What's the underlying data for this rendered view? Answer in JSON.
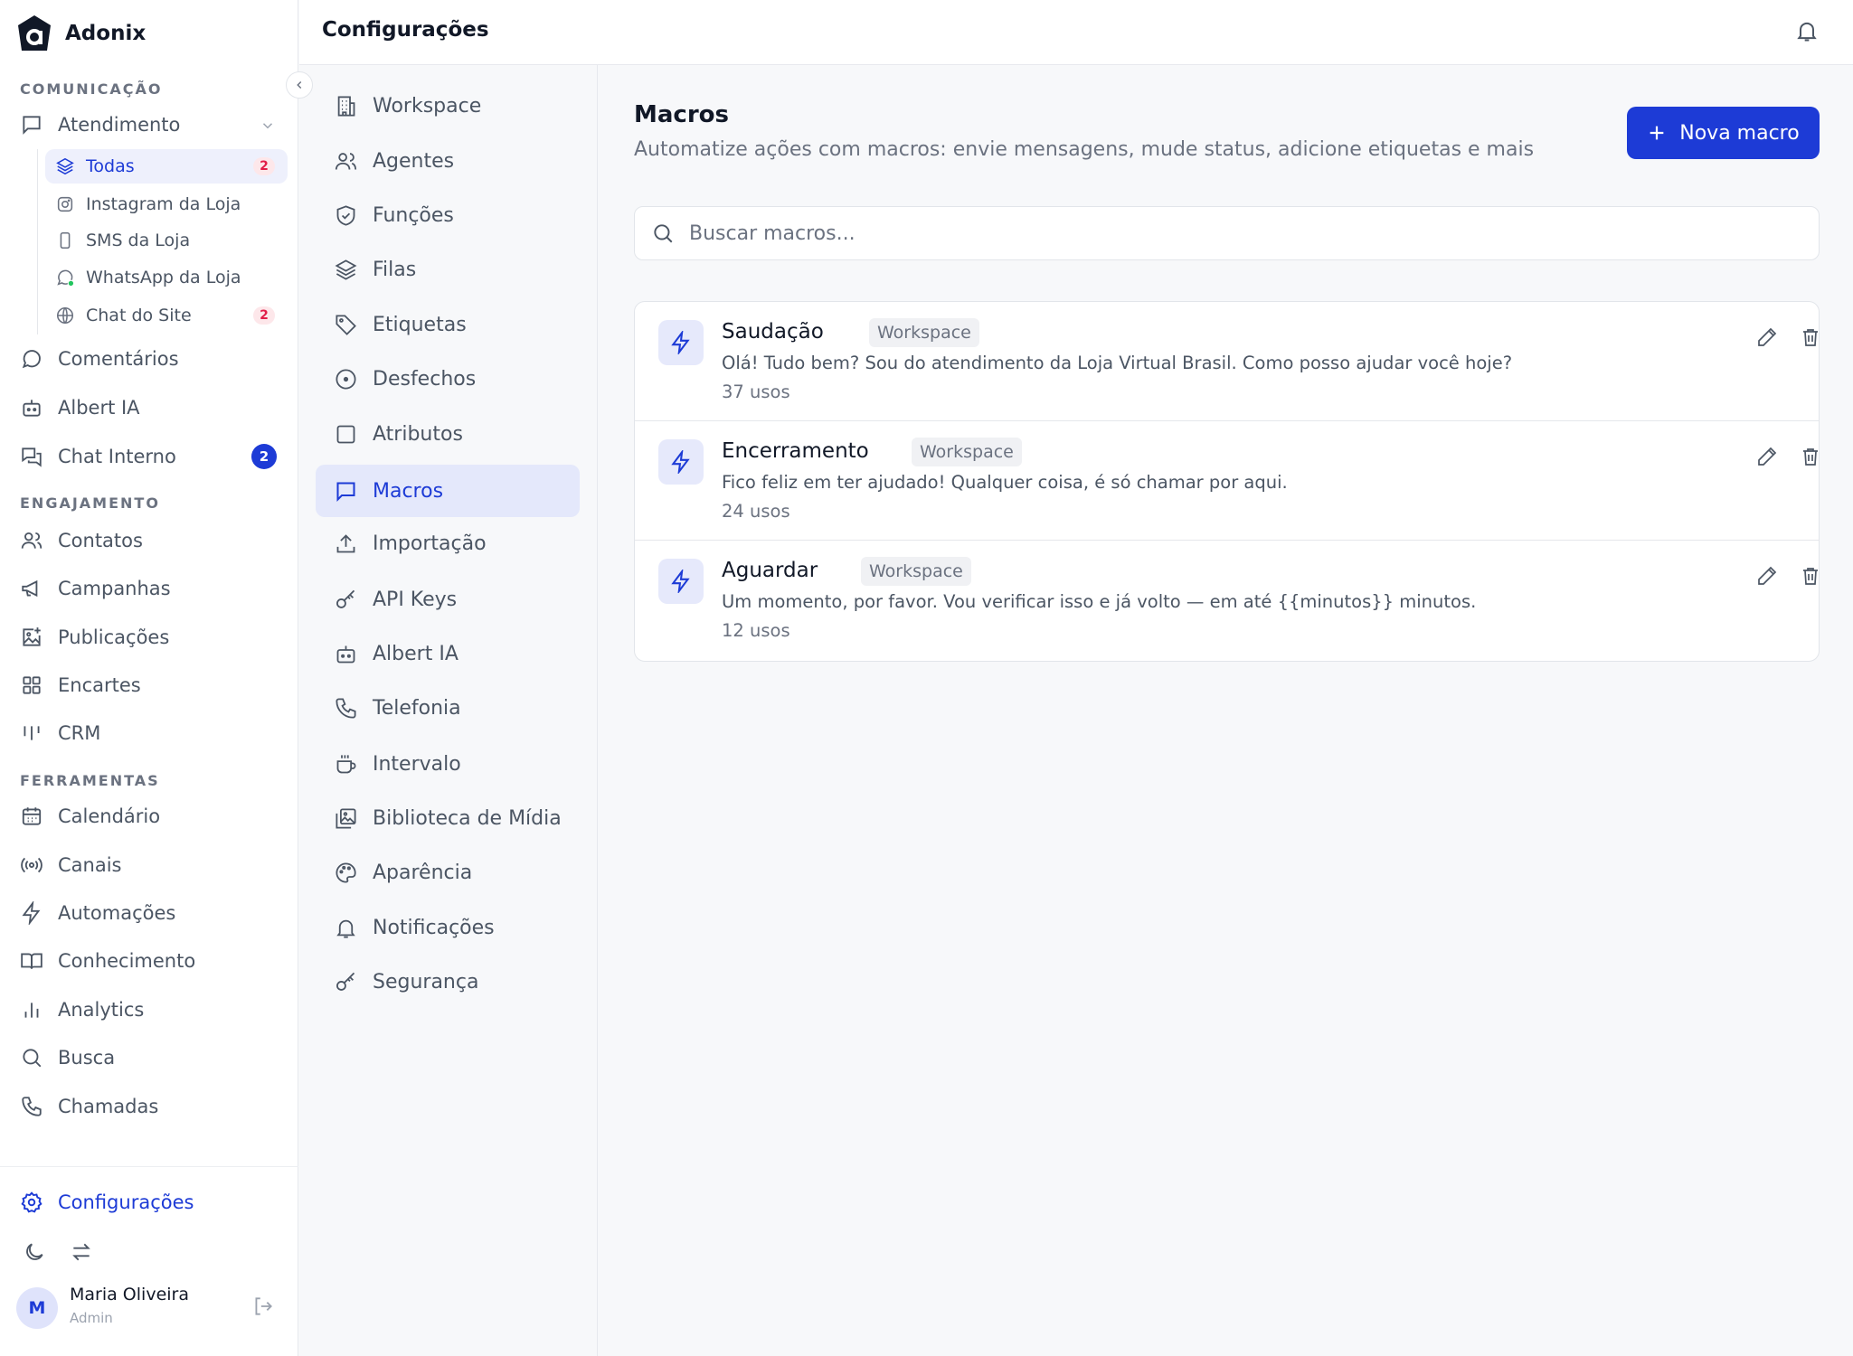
{
  "brand": {
    "name": "Adonix"
  },
  "sidebar": {
    "sections": {
      "comunicacao": "COMUNICAÇÃO",
      "engajamento": "ENGAJAMENTO",
      "ferramentas": "FERRAMENTAS"
    },
    "atendimento": "Atendimento",
    "inboxes": [
      {
        "label": "Todas",
        "badge": "2",
        "icon": "layers-icon",
        "active": true
      },
      {
        "label": "Instagram da Loja",
        "icon": "instagram-icon"
      },
      {
        "label": "SMS da Loja",
        "icon": "phone-device-icon"
      },
      {
        "label": "WhatsApp da Loja",
        "icon": "whatsapp-icon"
      },
      {
        "label": "Chat do Site",
        "badge": "2",
        "icon": "globe-icon"
      }
    ],
    "comunicacao_items": [
      {
        "label": "Comentários"
      },
      {
        "label": "Albert IA"
      },
      {
        "label": "Chat Interno",
        "badge": "2"
      }
    ],
    "engajamento_items": [
      {
        "label": "Contatos"
      },
      {
        "label": "Campanhas"
      },
      {
        "label": "Publicações"
      },
      {
        "label": "Encartes"
      },
      {
        "label": "CRM"
      }
    ],
    "ferramentas_items": [
      {
        "label": "Calendário"
      },
      {
        "label": "Canais"
      },
      {
        "label": "Automações"
      },
      {
        "label": "Conhecimento"
      },
      {
        "label": "Analytics"
      },
      {
        "label": "Busca"
      },
      {
        "label": "Chamadas"
      }
    ],
    "settings_link": "Configurações",
    "user": {
      "initial": "M",
      "name": "Maria Oliveira",
      "role": "Admin"
    }
  },
  "header": {
    "title": "Configurações"
  },
  "settings_nav": [
    {
      "label": "Workspace"
    },
    {
      "label": "Agentes"
    },
    {
      "label": "Funções"
    },
    {
      "label": "Filas"
    },
    {
      "label": "Etiquetas"
    },
    {
      "label": "Desfechos"
    },
    {
      "label": "Atributos"
    },
    {
      "label": "Macros",
      "active": true
    },
    {
      "label": "Importação"
    },
    {
      "label": "API Keys"
    },
    {
      "label": "Albert IA"
    },
    {
      "label": "Telefonia"
    },
    {
      "label": "Intervalo"
    },
    {
      "label": "Biblioteca de Mídia"
    },
    {
      "label": "Aparência"
    },
    {
      "label": "Notificações"
    },
    {
      "label": "Segurança"
    }
  ],
  "main": {
    "title": "Macros",
    "subtitle": "Automatize ações com macros: envie mensagens, mude status, adicione etiquetas e mais",
    "new_button": "Nova macro",
    "search_placeholder": "Buscar macros...",
    "macros": [
      {
        "name": "Saudação",
        "scope": "Workspace",
        "text": "Olá! Tudo bem? Sou do atendimento da Loja Virtual Brasil. Como posso ajudar você hoje?",
        "uses": "37 usos"
      },
      {
        "name": "Encerramento",
        "scope": "Workspace",
        "text": "Fico feliz em ter ajudado! Qualquer coisa, é só chamar por aqui.",
        "uses": "24 usos"
      },
      {
        "name": "Aguardar",
        "scope": "Workspace",
        "text": "Um momento, por favor. Vou verificar isso e já volto — em até {{minutos}} minutos.",
        "uses": "12 usos"
      }
    ]
  },
  "colors": {
    "accent": "#1d3bd6",
    "badge_red": "#e11d48",
    "online": "#22c55e"
  }
}
